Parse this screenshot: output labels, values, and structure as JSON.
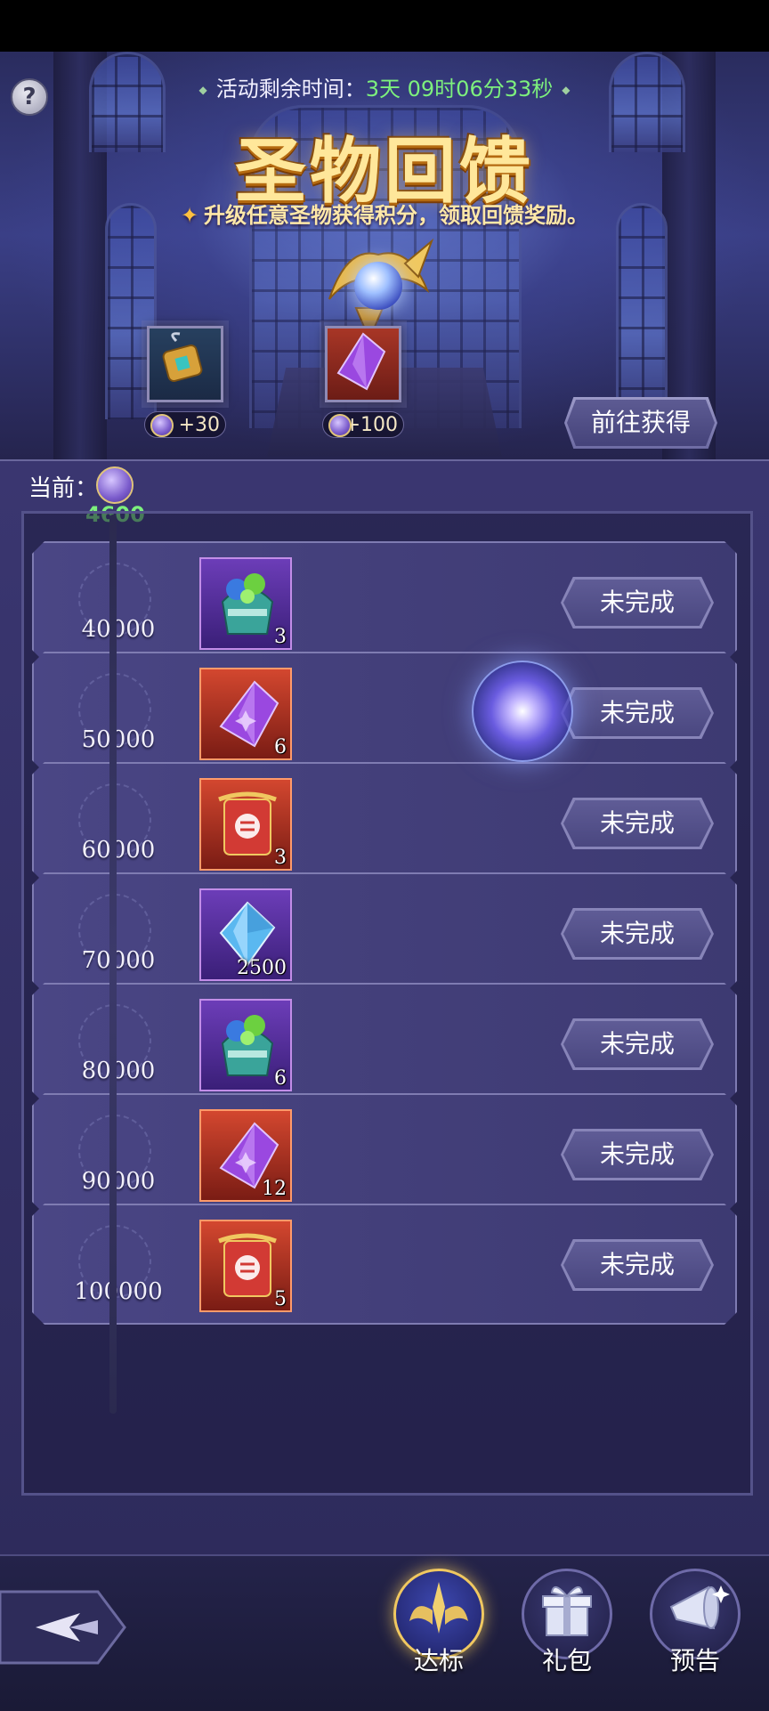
{
  "banner": {
    "help_label": "?",
    "timer_label": "活动剩余时间：",
    "timer_value": "3天  09时06分33秒",
    "title": "圣物回馈",
    "subtitle": "升级任意圣物获得积分，领取回馈奖励。",
    "sources": [
      {
        "points": "+30",
        "icon": "gold-amulet-icon"
      },
      {
        "points": "+100",
        "icon": "purple-crystal-icon"
      }
    ],
    "goto_label": "前往获得"
  },
  "progress": {
    "current_label": "当前：",
    "current_value": "4600"
  },
  "rewards": [
    {
      "score": "40000",
      "icon": "green-gem-pouch-icon",
      "qty": "3",
      "status": "未完成"
    },
    {
      "score": "50000",
      "icon": "purple-crystal-icon",
      "qty": "6",
      "status": "未完成"
    },
    {
      "score": "60000",
      "icon": "red-scroll-icon",
      "qty": "3",
      "status": "未完成"
    },
    {
      "score": "70000",
      "icon": "blue-diamond-icon",
      "qty": "2500",
      "status": "未完成"
    },
    {
      "score": "80000",
      "icon": "green-gem-pouch-icon",
      "qty": "6",
      "status": "未完成"
    },
    {
      "score": "90000",
      "icon": "purple-crystal-icon",
      "qty": "12",
      "status": "未完成"
    },
    {
      "score": "100000",
      "icon": "red-scroll-icon",
      "qty": "5",
      "status": "未完成"
    }
  ],
  "nav": {
    "tabs": [
      {
        "label": "达标",
        "icon": "wings-emblem-icon",
        "active": true
      },
      {
        "label": "礼包",
        "icon": "gift-box-icon",
        "active": false
      },
      {
        "label": "预告",
        "icon": "horn-icon",
        "active": false
      }
    ]
  }
}
